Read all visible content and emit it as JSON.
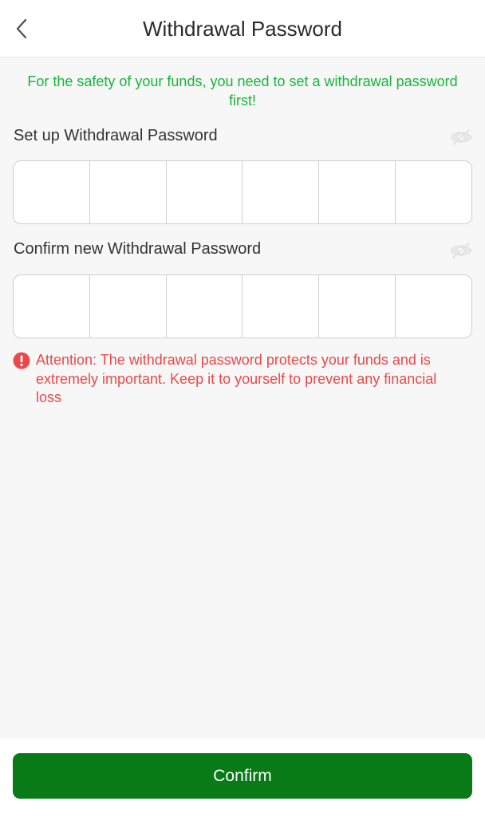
{
  "header": {
    "title": "Withdrawal Password",
    "back_icon": "chevron-left-icon"
  },
  "notice": {
    "text": "For the safety of your funds, you need to set a withdrawal password first!",
    "color": "#19b43c"
  },
  "setup": {
    "label": "Set up Withdrawal Password",
    "digits": [
      "",
      "",
      "",
      "",
      "",
      ""
    ],
    "toggle_icon": "eye-off-icon"
  },
  "confirm_field": {
    "label": "Confirm new Withdrawal Password",
    "digits": [
      "",
      "",
      "",
      "",
      "",
      ""
    ],
    "toggle_icon": "eye-off-icon"
  },
  "attention": {
    "icon": "exclamation-circle-icon",
    "text": "Attention: The withdrawal password protects your funds and is extremely important. Keep it to yourself to prevent any financial loss",
    "color": "#e84a4a"
  },
  "footer": {
    "confirm_label": "Confirm",
    "button_color": "#087a16"
  }
}
